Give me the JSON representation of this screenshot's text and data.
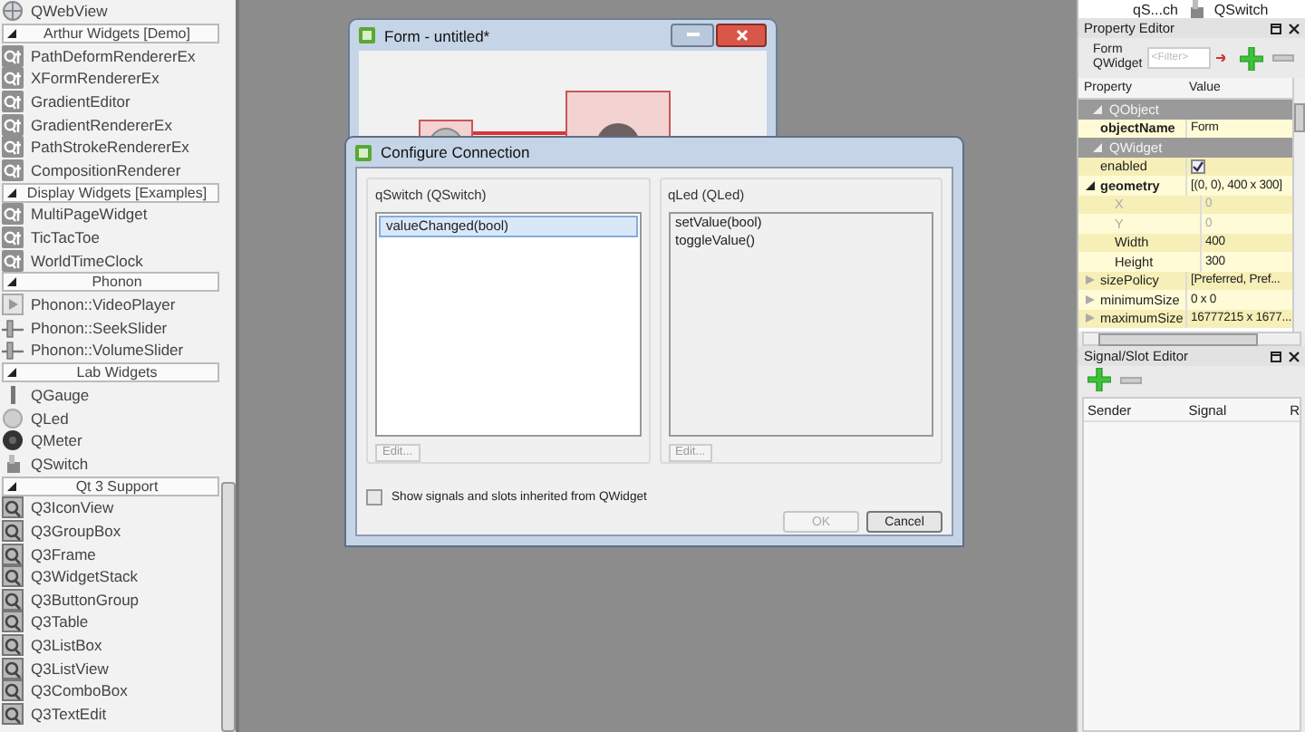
{
  "widget_box": {
    "top_item": {
      "label": "QWebView",
      "kind": "globe"
    },
    "groups": [
      {
        "title": "Arthur Widgets [Demo]",
        "expanded": true,
        "items": [
          {
            "label": "PathDeformRendererEx",
            "kind": "qt"
          },
          {
            "label": "XFormRendererEx",
            "kind": "qt"
          },
          {
            "label": "GradientEditor",
            "kind": "qt"
          },
          {
            "label": "GradientRendererEx",
            "kind": "qt"
          },
          {
            "label": "PathStrokeRendererEx",
            "kind": "qt"
          },
          {
            "label": "CompositionRenderer",
            "kind": "qt"
          }
        ]
      },
      {
        "title": "Display Widgets [Examples]",
        "expanded": true,
        "items": [
          {
            "label": "MultiPageWidget",
            "kind": "qt"
          },
          {
            "label": "TicTacToe",
            "kind": "qt"
          },
          {
            "label": "WorldTimeClock",
            "kind": "qt"
          }
        ]
      },
      {
        "title": "Phonon",
        "expanded": true,
        "items": [
          {
            "label": "Phonon::VideoPlayer",
            "kind": "play"
          },
          {
            "label": "Phonon::SeekSlider",
            "kind": "slider"
          },
          {
            "label": "Phonon::VolumeSlider",
            "kind": "slider"
          }
        ]
      },
      {
        "title": "Lab Widgets",
        "expanded": true,
        "items": [
          {
            "label": "QGauge",
            "kind": "gauge"
          },
          {
            "label": "QLed",
            "kind": "led"
          },
          {
            "label": "QMeter",
            "kind": "meter"
          },
          {
            "label": "QSwitch",
            "kind": "switch"
          }
        ]
      },
      {
        "title": "Qt 3 Support",
        "expanded": true,
        "items": [
          {
            "label": "Q3IconView",
            "kind": "q3"
          },
          {
            "label": "Q3GroupBox",
            "kind": "q3"
          },
          {
            "label": "Q3Frame",
            "kind": "q3"
          },
          {
            "label": "Q3WidgetStack",
            "kind": "q3"
          },
          {
            "label": "Q3ButtonGroup",
            "kind": "q3"
          },
          {
            "label": "Q3Table",
            "kind": "q3"
          },
          {
            "label": "Q3ListBox",
            "kind": "q3"
          },
          {
            "label": "Q3ListView",
            "kind": "q3"
          },
          {
            "label": "Q3ComboBox",
            "kind": "q3"
          },
          {
            "label": "Q3TextEdit",
            "kind": "q3"
          }
        ]
      }
    ]
  },
  "form_window": {
    "title": "Form - untitled*"
  },
  "dialog": {
    "title": "Configure Connection",
    "panels": [
      {
        "title": "qSwitch (QSwitch)",
        "enabled": true,
        "items": [
          {
            "label": "valueChanged(bool)",
            "selected": true
          }
        ],
        "edit_button": "Edit..."
      },
      {
        "title": "qLed (QLed)",
        "enabled": false,
        "items": [
          {
            "label": "setValue(bool)",
            "selected": false
          },
          {
            "label": "toggleValue()",
            "selected": false
          }
        ],
        "edit_button": "Edit..."
      }
    ],
    "inherit_checkbox": {
      "label": "Show signals and slots inherited from QWidget",
      "checked": false
    },
    "buttons": [
      {
        "label": "OK",
        "disabled": true
      },
      {
        "label": "Cancel",
        "disabled": false
      }
    ]
  },
  "object_inspector_row": {
    "object": "qS...ch",
    "class": "QSwitch"
  },
  "property_editor": {
    "title": "Property Editor",
    "object_name": "Form",
    "class_name": "QWidget",
    "filter": {
      "placeholder": "<Filter>"
    },
    "columns": [
      "Property",
      "Value"
    ],
    "rows": [
      {
        "kind": "group",
        "name": "QObject",
        "expanded": true,
        "children": [
          {
            "kind": "text",
            "name": "objectName",
            "value": "Form",
            "bold": true,
            "disabled": false
          }
        ]
      },
      {
        "kind": "group",
        "name": "QWidget",
        "expanded": true,
        "children": [
          {
            "kind": "checkbox",
            "name": "enabled",
            "checked": true,
            "bold": false,
            "disabled": false
          },
          {
            "kind": "text",
            "name": "geometry",
            "value": "[(0, 0), 400 x 300]",
            "bold": true,
            "disabled": false,
            "expanded": true,
            "children": [
              {
                "kind": "text",
                "name": "X",
                "value": "0",
                "bold": false,
                "disabled": true
              },
              {
                "kind": "text",
                "name": "Y",
                "value": "0",
                "bold": false,
                "disabled": true
              },
              {
                "kind": "text",
                "name": "Width",
                "value": "400",
                "bold": false,
                "disabled": false
              },
              {
                "kind": "text",
                "name": "Height",
                "value": "300",
                "bold": false,
                "disabled": false
              }
            ]
          },
          {
            "kind": "text",
            "name": "sizePolicy",
            "value": "[Preferred, Pref...",
            "bold": false,
            "disabled": false,
            "expanded": false
          },
          {
            "kind": "text",
            "name": "minimumSize",
            "value": "0 x 0",
            "bold": false,
            "disabled": false,
            "expanded": false
          },
          {
            "kind": "text",
            "name": "maximumSize",
            "value": "16777215 x 1677...",
            "bold": false,
            "disabled": false,
            "expanded": false
          }
        ]
      }
    ]
  },
  "signal_slot_editor": {
    "title": "Signal/Slot Editor",
    "columns": [
      "Sender",
      "Signal",
      "R"
    ]
  }
}
